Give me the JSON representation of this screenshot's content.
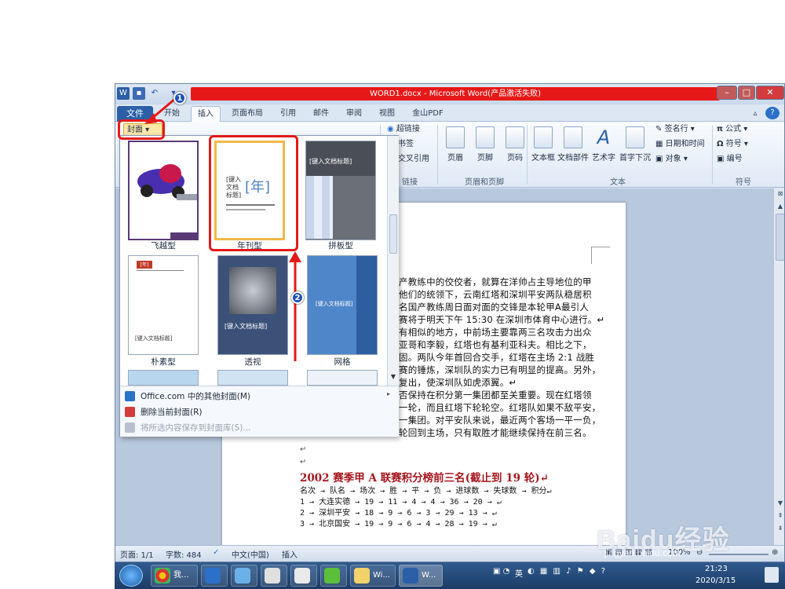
{
  "window": {
    "title": "WORD1.docx - Microsoft Word(产品激活失败)",
    "controls": [
      "–",
      "□",
      "✕"
    ]
  },
  "tabs": {
    "file": "文件",
    "items": [
      "开始",
      "插入",
      "页面布局",
      "引用",
      "邮件",
      "审阅",
      "视图",
      "金山PDF"
    ],
    "active": "插入"
  },
  "ribbon": {
    "cover_button": "封面",
    "links": {
      "hyperlink": "超链接",
      "bookmark": "书签",
      "crossref": "交叉引用",
      "group": "链接"
    },
    "header_footer": {
      "header": "页眉",
      "footer": "页脚",
      "page_number": "页码",
      "group": "页眉和页脚"
    },
    "text": {
      "textbox": "文本框",
      "quickparts": "文档部件",
      "wordart": "艺术字",
      "dropcap": "首字下沉",
      "signature": "签名行",
      "datetime": "日期和时间",
      "object": "对象",
      "group": "文本"
    },
    "symbols": {
      "equation": "公式",
      "symbol": "符号",
      "numbering": "编号",
      "group": "符号"
    }
  },
  "gallery": {
    "covers": [
      {
        "label": "飞越型"
      },
      {
        "label": "年刊型",
        "year_text": "[年]",
        "title_text": "[键入文档标题]"
      },
      {
        "label": "拼板型",
        "title_text": "[键入文档标题]"
      },
      {
        "label": "朴素型",
        "year_text": "[年]",
        "title_text": "[键入文档标题]"
      },
      {
        "label": "透视",
        "title_text": "[键入文档标题]"
      },
      {
        "label": "网格",
        "title_text": "[键入文档标题]"
      }
    ],
    "menu": [
      {
        "label": "Office.com 中的其他封面(M)",
        "enabled": true
      },
      {
        "label": "删除当前封面(R)",
        "enabled": true
      },
      {
        "label": "将所选内容保存到封面库(S)...",
        "enabled": false
      }
    ]
  },
  "document": {
    "paragraph_lines": [
      "产教练中的佼佼者，就算在洋帅占主导地位的甲",
      "他们的统领下，云南红塔和深圳平安两队稳居积",
      "名国产教练周日面对面的交锋是本轮甲A最引人",
      "赛将于明天下午 15:30 在深圳市体育中心进行。↵",
      "有相似的地方，中前场主要靠两三名攻击力出众",
      "亚哥和李毅，红塔也有基利亚科夫。相比之下，",
      "固。两队今年首回合交手，红塔在主场 2:1 战胜",
      "赛的锤炼，深圳队的实力已有明显的提高。另外，",
      "复出，使深圳队如虎添翼。↵",
      "否保持在积分第一集团都至关重要。现在红塔领",
      "一轮，而且红塔下轮轮空。红塔队如果不敌平安，",
      "一集团。对平安队来说，最近两个客场一平一负，",
      "轮回到主场，只有取胜才能继续保持在前三名。"
    ],
    "table_title": "2002 赛季甲 A 联赛积分榜前三名(截止到 19 轮)↵",
    "table_header": "名次 → 队名    → 场次 → 胜 → 平 → 负 → 进球数 → 失球数 → 积分↵",
    "table_rows": [
      "1  →  大连实德  →  19  →  11 → 4 → 4  →  36   →   20  →  ↵",
      "2  →  深圳平安  →  18  →  9 → 6 → 3  →  29   →   13  →  ↵",
      "3  →  北京国安  →  19  →  9 → 6 → 4  →  28   →   19  →  ↵"
    ]
  },
  "statusbar": {
    "page": "页面: 1/1",
    "words": "字数: 484",
    "language": "中文(中国)",
    "mode": "插入",
    "zoom": "100%"
  },
  "annotations": {
    "step1": "1",
    "step2": "2"
  },
  "taskbar": {
    "buttons": [
      "我...",
      "Wi...",
      "W..."
    ],
    "time": "21:23",
    "date": "2020/3/15",
    "ime": "英"
  },
  "watermark": {
    "brand": "Baidu经验",
    "url": "jingyan.baidu.com"
  }
}
